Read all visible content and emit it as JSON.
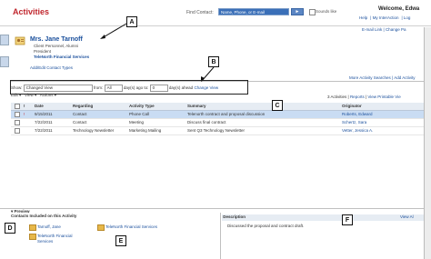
{
  "header": {
    "title": "Activities",
    "find_label": "Find Contact:",
    "find_placeholder": "Name, Phone, or E-mail",
    "find_button": "►",
    "sounds_like": "Sounds like",
    "welcome": "Welcome, Edwa",
    "links": [
      "Help",
      "My InterAction",
      "Log"
    ],
    "email_links": [
      "E-mail Link",
      "Change Pa"
    ]
  },
  "contact": {
    "name": "Mrs. Jane Tarnoff",
    "lines": [
      "Client Personnel, Alumni",
      "President"
    ],
    "firm": "TeleNorth Financial Services",
    "add_edit": "Add/Edit Contact Types"
  },
  "more_links": "More Activity Searches | Add Activity",
  "filter": {
    "show_label": "Show:",
    "show_value": "Changed View",
    "from_label": "from:",
    "from_value": "All",
    "ago_label": "day(s) ago to:",
    "to_value": "0",
    "ahead_label": "day(s) ahead",
    "change_view": "Change View"
  },
  "toolbar": {
    "edit": "Edit",
    "view": "View",
    "actions": "Actions",
    "count": "3 Activities",
    "reports": "Reports",
    "printable": "View Printable Vie"
  },
  "table": {
    "headers": [
      "Date",
      "Regarding",
      "Activity Type",
      "Summary",
      "Originator"
    ],
    "rows": [
      {
        "date": "9/15/2011",
        "regarding": "Contact",
        "type": "Phone Call",
        "summary": "Telenorth contract and proposal discussion",
        "originator": "Roberts, Edward"
      },
      {
        "date": "7/22/2011",
        "regarding": "Contact",
        "type": "Meeting",
        "summary": "Discuss final contract",
        "originator": "Schertz, Sara"
      },
      {
        "date": "7/22/2011",
        "regarding": "Technology Newsletter",
        "type": "Marketing Mailing",
        "summary": "Sent Q3 Technology Newsletter",
        "originator": "Vetter, Jessica A."
      }
    ]
  },
  "preview": {
    "label": "Preview",
    "contacts_head": "Contacts Included on this Activity",
    "contacts": [
      "Tarnoff, Jane",
      "TeleNorth Financial Services",
      "TeleNorth Financial Services"
    ],
    "description_head": "Description",
    "view_all": "View Al",
    "description": "Discussed the proposal and contract draft."
  },
  "callouts": [
    "A",
    "B",
    "C",
    "D",
    "E",
    "F"
  ]
}
